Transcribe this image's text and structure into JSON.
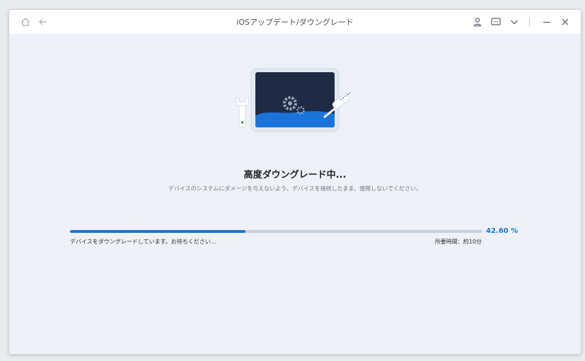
{
  "window": {
    "title": "iOSアップデート/ダウングレード"
  },
  "toolbar": {
    "home_icon": "home-icon",
    "back_icon": "back-arrow-icon",
    "account_icon": "user-icon",
    "feedback_icon": "chat-icon",
    "menu_icon": "chevron-down-icon",
    "minimize_icon": "minimize-icon",
    "close_icon": "close-icon"
  },
  "main": {
    "heading": "高度ダウングレード中...",
    "subtext": "デバイスのシステムにダメージを与えないよう、デバイスを接続したまま、使用しないでください。",
    "progress": {
      "value": 42.6,
      "percent_label": "42.60 %",
      "status_text": "デバイスをダウングレードしています。お待ちください...",
      "time_label": "所要時間：約10分"
    }
  },
  "colors": {
    "accent": "#1a73d9",
    "track": "#c4d1e1",
    "background": "#eef2f8",
    "screen": "#1f2b45"
  }
}
